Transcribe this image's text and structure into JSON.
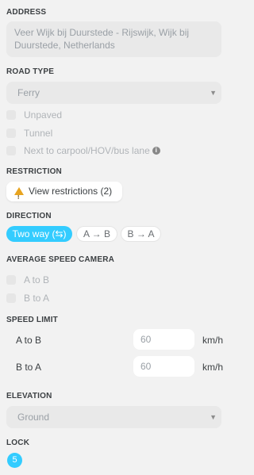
{
  "address": {
    "label": "ADDRESS",
    "value_line1": "Veer Wijk bij Duurstede - Rijswijk, Wijk bij",
    "value_line2": "Duurstede, Netherlands"
  },
  "road_type": {
    "label": "ROAD TYPE",
    "selected": "Ferry",
    "options": [
      {
        "label": "Unpaved",
        "checked": false
      },
      {
        "label": "Tunnel",
        "checked": false
      },
      {
        "label": "Next to carpool/HOV/bus lane",
        "checked": false
      }
    ]
  },
  "restriction": {
    "label": "RESTRICTION",
    "button_label": "View restrictions (2)"
  },
  "direction": {
    "label": "DIRECTION",
    "options": [
      "Two way (⇆)",
      "A → B",
      "B → A"
    ],
    "selected": "Two way (⇆)"
  },
  "speed_camera": {
    "label": "AVERAGE SPEED CAMERA",
    "options": [
      {
        "label": "A to B",
        "checked": false
      },
      {
        "label": "B to A",
        "checked": false
      }
    ]
  },
  "speed_limit": {
    "label": "SPEED LIMIT",
    "rows": [
      {
        "label": "A to B",
        "placeholder": "60",
        "unit": "km/h"
      },
      {
        "label": "B to A",
        "placeholder": "60",
        "unit": "km/h"
      }
    ]
  },
  "elevation": {
    "label": "ELEVATION",
    "selected": "Ground"
  },
  "lock": {
    "label": "LOCK",
    "value": "5"
  },
  "colors": {
    "accent": "#33ccff",
    "background": "#f2f2f2",
    "warning": "#e8a420"
  }
}
